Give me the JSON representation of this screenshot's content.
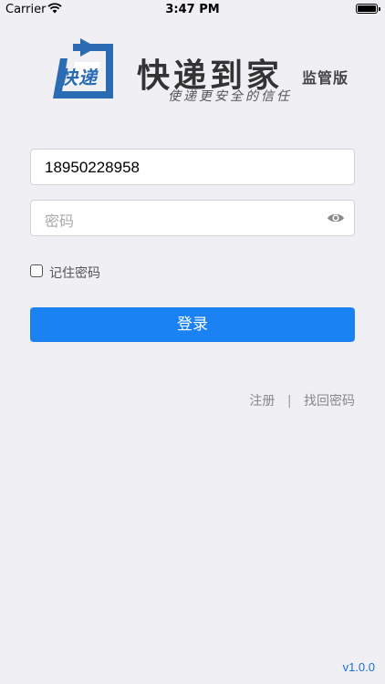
{
  "status_bar": {
    "carrier": "Carrier",
    "time": "3:47 PM"
  },
  "logo": {
    "mark_text": "快递",
    "brand_name": "快递到家",
    "edition": "监管版",
    "slogan": "使递更安全的信任",
    "mark_color": "#2a6bb3"
  },
  "form": {
    "phone_value": "18950228958",
    "password_placeholder": "密码",
    "remember_label": "记住密码",
    "remember_checked": false,
    "login_label": "登录",
    "accent_color": "#1b82f4"
  },
  "links": {
    "register": "注册",
    "separator": "|",
    "forgot_password": "找回密码"
  },
  "version": "v1.0.0"
}
